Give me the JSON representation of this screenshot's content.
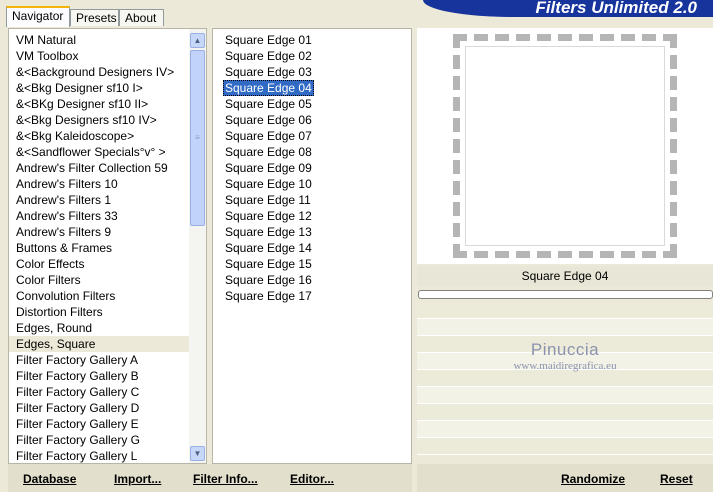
{
  "tabs": [
    {
      "label": "Navigator",
      "active": true
    },
    {
      "label": "Presets",
      "active": false
    },
    {
      "label": "About",
      "active": false
    }
  ],
  "brand": "Filters Unlimited 2.0",
  "categories": [
    {
      "label": "VM Natural",
      "selected": false
    },
    {
      "label": "VM Toolbox",
      "selected": false
    },
    {
      "label": "&<Background Designers IV>",
      "selected": false
    },
    {
      "label": "&<Bkg Designer sf10 I>",
      "selected": false
    },
    {
      "label": "&<BKg Designer sf10 II>",
      "selected": false
    },
    {
      "label": "&<Bkg Designers sf10 IV>",
      "selected": false
    },
    {
      "label": "&<Bkg Kaleidoscope>",
      "selected": false
    },
    {
      "label": "&<Sandflower Specials°v° >",
      "selected": false
    },
    {
      "label": "Andrew's Filter Collection 59",
      "selected": false
    },
    {
      "label": "Andrew's Filters 10",
      "selected": false
    },
    {
      "label": "Andrew's Filters 1",
      "selected": false
    },
    {
      "label": "Andrew's Filters 33",
      "selected": false
    },
    {
      "label": "Andrew's Filters 9",
      "selected": false
    },
    {
      "label": "Buttons & Frames",
      "selected": false
    },
    {
      "label": "Color Effects",
      "selected": false
    },
    {
      "label": "Color Filters",
      "selected": false
    },
    {
      "label": "Convolution Filters",
      "selected": false
    },
    {
      "label": "Distortion Filters",
      "selected": false
    },
    {
      "label": "Edges, Round",
      "selected": false
    },
    {
      "label": "Edges, Square",
      "selected": true
    },
    {
      "label": "Filter Factory Gallery A",
      "selected": false
    },
    {
      "label": "Filter Factory Gallery B",
      "selected": false
    },
    {
      "label": "Filter Factory Gallery C",
      "selected": false
    },
    {
      "label": "Filter Factory Gallery D",
      "selected": false
    },
    {
      "label": "Filter Factory Gallery E",
      "selected": false
    },
    {
      "label": "Filter Factory Gallery G",
      "selected": false
    },
    {
      "label": "Filter Factory Gallery L",
      "selected": false
    }
  ],
  "filters": [
    {
      "label": "Square Edge 01",
      "selected": false
    },
    {
      "label": "Square Edge 02",
      "selected": false
    },
    {
      "label": "Square Edge 03",
      "selected": false
    },
    {
      "label": "Square Edge 04",
      "selected": true
    },
    {
      "label": "Square Edge 05",
      "selected": false
    },
    {
      "label": "Square Edge 06",
      "selected": false
    },
    {
      "label": "Square Edge 07",
      "selected": false
    },
    {
      "label": "Square Edge 08",
      "selected": false
    },
    {
      "label": "Square Edge 09",
      "selected": false
    },
    {
      "label": "Square Edge 10",
      "selected": false
    },
    {
      "label": "Square Edge 11",
      "selected": false
    },
    {
      "label": "Square Edge 12",
      "selected": false
    },
    {
      "label": "Square Edge 13",
      "selected": false
    },
    {
      "label": "Square Edge 14",
      "selected": false
    },
    {
      "label": "Square Edge 15",
      "selected": false
    },
    {
      "label": "Square Edge 16",
      "selected": false
    },
    {
      "label": "Square Edge 17",
      "selected": false
    }
  ],
  "preview": {
    "label": "Square Edge 04"
  },
  "watermark": {
    "name": "Pinuccia",
    "url": "www.maidiregrafica.eu"
  },
  "buttons": {
    "database": "Database",
    "import": "Import...",
    "filter_info": "Filter Info...",
    "editor": "Editor...",
    "randomize": "Randomize",
    "reset": "Reset"
  },
  "icons": {
    "scroll_up": "arrow-up-icon",
    "scroll_down": "arrow-down-icon",
    "thumb_grip": "grip-icon"
  },
  "colors": {
    "selection": "#316ac5",
    "brand_bar": "#17349c",
    "tab_highlight": "#f5b40a",
    "dialog_bg": "#ece9d8"
  }
}
